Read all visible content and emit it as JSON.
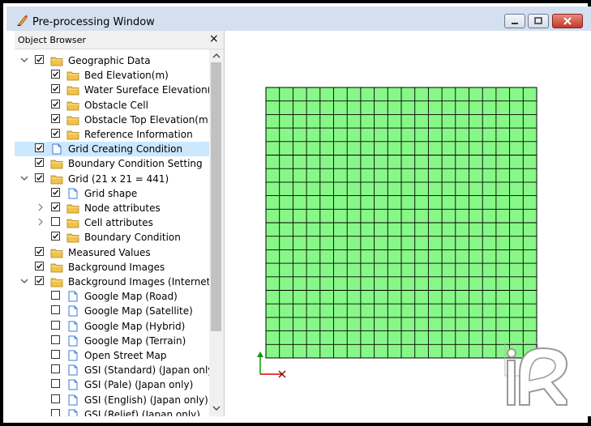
{
  "window": {
    "title": "Pre-processing Window"
  },
  "object_browser": {
    "title": "Object Browser",
    "close_glyph": "×",
    "items": [
      {
        "label": "Geographic Data",
        "level": 0,
        "expander": "open",
        "checked": true,
        "icon": "folder-icon"
      },
      {
        "label": "Bed Elevation(m)",
        "level": 1,
        "expander": "none",
        "checked": true,
        "icon": "folder-icon"
      },
      {
        "label": "Water Sureface Elevation(...",
        "level": 1,
        "expander": "none",
        "checked": true,
        "icon": "folder-icon"
      },
      {
        "label": "Obstacle Cell",
        "level": 1,
        "expander": "none",
        "checked": true,
        "icon": "folder-icon"
      },
      {
        "label": "Obstacle Top Elevation(m)",
        "level": 1,
        "expander": "none",
        "checked": true,
        "icon": "folder-icon"
      },
      {
        "label": "Reference Information",
        "level": 1,
        "expander": "none",
        "checked": true,
        "icon": "folder-icon"
      },
      {
        "label": "Grid Creating Condition",
        "level": 0,
        "expander": "none",
        "checked": true,
        "icon": "document-icon",
        "selected": true
      },
      {
        "label": "Boundary Condition Setting",
        "level": 0,
        "expander": "none",
        "checked": true,
        "icon": "folder-icon"
      },
      {
        "label": "Grid (21 x 21 = 441)",
        "level": 0,
        "expander": "open",
        "checked": true,
        "icon": "folder-icon"
      },
      {
        "label": "Grid shape",
        "level": 1,
        "expander": "none",
        "checked": true,
        "icon": "document-icon"
      },
      {
        "label": "Node attributes",
        "level": 1,
        "expander": "closed",
        "checked": true,
        "icon": "folder-icon"
      },
      {
        "label": "Cell attributes",
        "level": 1,
        "expander": "closed",
        "checked": false,
        "icon": "folder-icon"
      },
      {
        "label": "Boundary Condition",
        "level": 1,
        "expander": "none",
        "checked": true,
        "icon": "folder-icon"
      },
      {
        "label": "Measured Values",
        "level": 0,
        "expander": "none",
        "checked": true,
        "icon": "folder-icon"
      },
      {
        "label": "Background Images",
        "level": 0,
        "expander": "none",
        "checked": true,
        "icon": "folder-icon"
      },
      {
        "label": "Background Images (Internet)",
        "level": 0,
        "expander": "open",
        "checked": true,
        "icon": "folder-icon"
      },
      {
        "label": "Google Map (Road)",
        "level": 1,
        "expander": "none",
        "checked": false,
        "icon": "document-icon"
      },
      {
        "label": "Google Map (Satellite)",
        "level": 1,
        "expander": "none",
        "checked": false,
        "icon": "document-icon"
      },
      {
        "label": "Google Map (Hybrid)",
        "level": 1,
        "expander": "none",
        "checked": false,
        "icon": "document-icon"
      },
      {
        "label": "Google Map (Terrain)",
        "level": 1,
        "expander": "none",
        "checked": false,
        "icon": "document-icon"
      },
      {
        "label": "Open Street Map",
        "level": 1,
        "expander": "none",
        "checked": false,
        "icon": "document-icon"
      },
      {
        "label": "GSI (Standard) (Japan only)",
        "level": 1,
        "expander": "none",
        "checked": false,
        "icon": "document-icon"
      },
      {
        "label": "GSI (Pale) (Japan only)",
        "level": 1,
        "expander": "none",
        "checked": false,
        "icon": "document-icon"
      },
      {
        "label": "GSI (English) (Japan only)",
        "level": 1,
        "expander": "none",
        "checked": false,
        "icon": "document-icon"
      },
      {
        "label": "GSI (Relief) (Japan only)",
        "level": 1,
        "expander": "none",
        "checked": false,
        "icon": "document-icon"
      }
    ]
  },
  "grid": {
    "cells_i": 20,
    "cells_j": 20,
    "fill_color": "#87f887",
    "line_color": "#000000"
  },
  "axes": {
    "x_color": "#e00000",
    "y_color": "#00a000"
  },
  "colors": {
    "titlebar": "#d4dff0",
    "selected_row": "#cce8ff",
    "folder": "#f3c24a",
    "document": "#3c78d8"
  },
  "logo": "iRIC-logo"
}
